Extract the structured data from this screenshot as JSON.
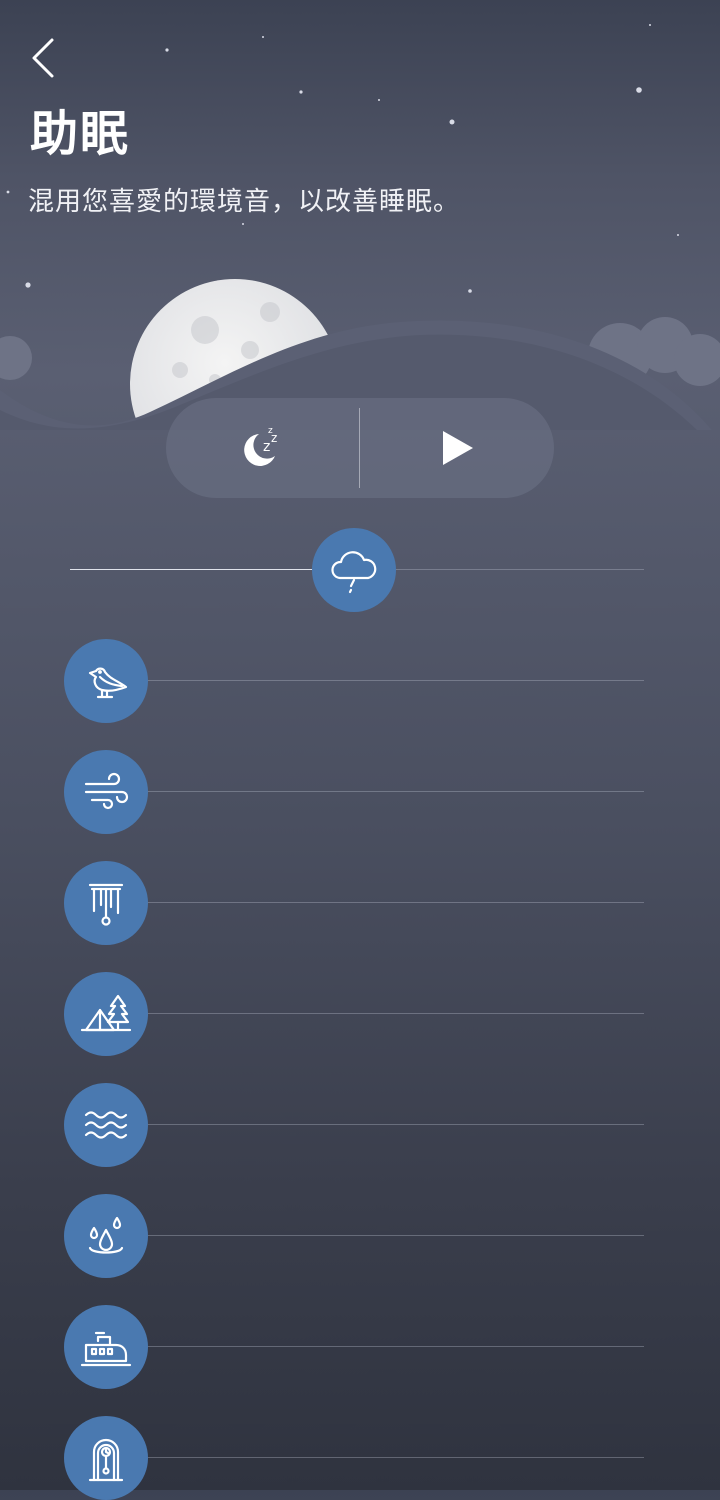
{
  "header": {
    "title": "助眠",
    "subtitle": "混用您喜愛的環境音，以改善睡眠。"
  },
  "colors": {
    "accent": "#4a79b0",
    "background_top": "#3c4253",
    "background_bottom": "#2f333f"
  },
  "controls": {
    "timer_icon": "moon-sleep-icon",
    "play_icon": "play-icon"
  },
  "sounds": [
    {
      "icon": "rain-cloud-icon",
      "level": 0.5
    },
    {
      "icon": "bird-icon",
      "level": 0.0
    },
    {
      "icon": "wind-icon",
      "level": 0.0
    },
    {
      "icon": "wind-chime-icon",
      "level": 0.0
    },
    {
      "icon": "campfire-tent-icon",
      "level": 0.0
    },
    {
      "icon": "waves-icon",
      "level": 0.0
    },
    {
      "icon": "water-drop-icon",
      "level": 0.0
    },
    {
      "icon": "train-icon",
      "level": 0.0
    },
    {
      "icon": "clock-icon",
      "level": 0.0
    }
  ]
}
